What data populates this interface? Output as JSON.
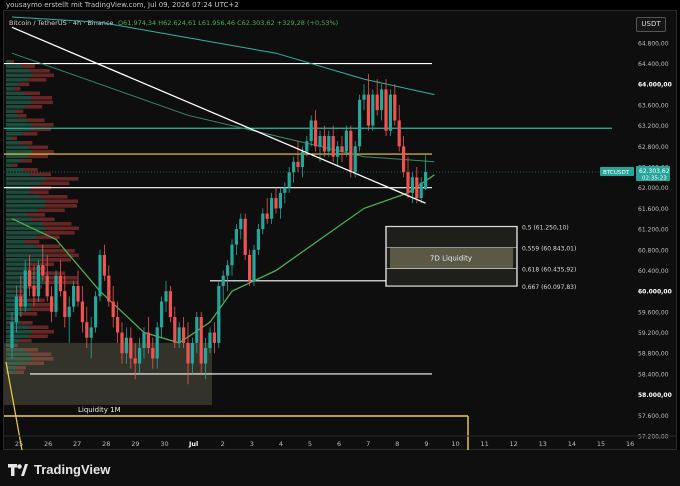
{
  "meta": {
    "author_line": "yousaymo erstellt mit TradingView.com, Jul 09, 2026 07:24 UTC+2"
  },
  "header": {
    "symbol": "Bitcoin / TetherUS · 4h · Binance",
    "ohlc": "O61.974,34 H62.624,61 L61.956,46 C62.303,62 +329,28 (+0,53%)"
  },
  "currency_button": "USDT",
  "brand": "TradingView",
  "colors": {
    "background": "#0e0e0e",
    "up": "#26a69a",
    "up_bright": "#4caf50",
    "down": "#ef5350",
    "ema_green": "#4caf50",
    "teal_line": "#2fb4a0",
    "yellow": "#f0d04a",
    "white": "#ffffff",
    "price_tag": "#26a69a",
    "zone_fill": "#8a8a6a"
  },
  "chart_data": {
    "type": "candlestick",
    "interval": "4h",
    "price_axis": {
      "min": 57200,
      "max": 65300,
      "ticks": [
        "64.800,00",
        "64.400,00",
        "64.000,00",
        "63.600,00",
        "63.200,00",
        "62.800,00",
        "62.400,00",
        "62.000,00",
        "61.600,00",
        "61.200,00",
        "60.800,00",
        "60.400,00",
        "60.000,00",
        "59.600,00",
        "59.200,00",
        "58.800,00",
        "58.400,00",
        "58.000,00",
        "57.600,00",
        "57.200,00"
      ],
      "tick_values": [
        64800,
        64400,
        64000,
        63600,
        63200,
        62800,
        62400,
        62000,
        61600,
        61200,
        60800,
        60400,
        60000,
        59600,
        59200,
        58800,
        58400,
        58000,
        57600,
        57200
      ],
      "bold_ticks": [
        64000,
        60000,
        58000
      ]
    },
    "time_axis": {
      "labels": [
        "25",
        "26",
        "27",
        "28",
        "29",
        "30",
        "Jul",
        "2",
        "3",
        "4",
        "5",
        "6",
        "7",
        "8",
        "9",
        "10",
        "11",
        "12",
        "13",
        "14",
        "15",
        "16"
      ],
      "bold_labels": [
        "Jul"
      ]
    },
    "current_price": {
      "symbol": "BTCUSDT",
      "price": "62.303,62",
      "value": 62303.62,
      "countdown": "02:35:23"
    },
    "candles": [
      [
        58900,
        59600,
        58700,
        59400
      ],
      [
        59400,
        60100,
        59200,
        59900
      ],
      [
        59900,
        60300,
        59500,
        59700
      ],
      [
        59700,
        60600,
        59600,
        60400
      ],
      [
        60400,
        60700,
        59900,
        60100
      ],
      [
        60100,
        60500,
        59700,
        59900
      ],
      [
        59900,
        60600,
        59800,
        60500
      ],
      [
        60500,
        60900,
        60200,
        60300
      ],
      [
        60300,
        60700,
        59800,
        59900
      ],
      [
        59900,
        60100,
        59400,
        59600
      ],
      [
        59600,
        60400,
        59500,
        60300
      ],
      [
        60300,
        60600,
        59900,
        60000
      ],
      [
        60000,
        60300,
        59300,
        59500
      ],
      [
        59500,
        59900,
        59000,
        59700
      ],
      [
        59700,
        60200,
        59600,
        60100
      ],
      [
        60100,
        60400,
        59700,
        59800
      ],
      [
        59800,
        60100,
        59200,
        59400
      ],
      [
        59400,
        59700,
        58900,
        59100
      ],
      [
        59100,
        59500,
        58700,
        59300
      ],
      [
        59300,
        60000,
        59200,
        59900
      ],
      [
        59900,
        60800,
        59800,
        60700
      ],
      [
        60700,
        60900,
        60200,
        60300
      ],
      [
        60300,
        60500,
        59700,
        59800
      ],
      [
        59800,
        60100,
        59300,
        59500
      ],
      [
        59500,
        59800,
        59000,
        59200
      ],
      [
        59200,
        59400,
        58600,
        58800
      ],
      [
        58800,
        59300,
        58600,
        59100
      ],
      [
        59100,
        59300,
        58500,
        58700
      ],
      [
        58700,
        59000,
        58300,
        58600
      ],
      [
        58600,
        59100,
        58400,
        58900
      ],
      [
        58900,
        59300,
        58700,
        59200
      ],
      [
        59200,
        59500,
        58800,
        58900
      ],
      [
        58900,
        59100,
        58500,
        58700
      ],
      [
        58700,
        59400,
        58500,
        59300
      ],
      [
        59300,
        59900,
        59100,
        59800
      ],
      [
        59800,
        60200,
        59600,
        60000
      ],
      [
        60000,
        60100,
        59400,
        59500
      ],
      [
        59500,
        59700,
        58900,
        59000
      ],
      [
        59000,
        59400,
        58900,
        59300
      ],
      [
        59300,
        59500,
        58900,
        59000
      ],
      [
        59000,
        59400,
        58200,
        58600
      ],
      [
        58600,
        59100,
        58400,
        59000
      ],
      [
        59000,
        59600,
        58800,
        59500
      ],
      [
        59500,
        59600,
        58400,
        58600
      ],
      [
        58600,
        59100,
        58300,
        58900
      ],
      [
        58900,
        59300,
        58800,
        59200
      ],
      [
        59200,
        59400,
        58800,
        59000
      ],
      [
        59000,
        60200,
        58900,
        60100
      ],
      [
        60100,
        60400,
        59800,
        60300
      ],
      [
        60300,
        60600,
        60000,
        60500
      ],
      [
        60500,
        61000,
        60300,
        60900
      ],
      [
        60900,
        61300,
        60700,
        61200
      ],
      [
        61200,
        61500,
        61000,
        61400
      ],
      [
        61400,
        61500,
        60600,
        60700
      ],
      [
        60700,
        60800,
        60100,
        60200
      ],
      [
        60200,
        60900,
        60100,
        60800
      ],
      [
        60800,
        61300,
        60700,
        61200
      ],
      [
        61200,
        61600,
        61100,
        61500
      ],
      [
        61500,
        61800,
        61300,
        61400
      ],
      [
        61400,
        61900,
        61300,
        61800
      ],
      [
        61800,
        62000,
        61500,
        61600
      ],
      [
        61600,
        62000,
        61400,
        61900
      ],
      [
        61900,
        62100,
        61700,
        62000
      ],
      [
        62000,
        62400,
        61900,
        62300
      ],
      [
        62300,
        62600,
        62100,
        62500
      ],
      [
        62500,
        62900,
        62300,
        62400
      ],
      [
        62400,
        62800,
        62200,
        62700
      ],
      [
        62700,
        63000,
        62600,
        62900
      ],
      [
        62900,
        63400,
        62800,
        63300
      ],
      [
        63300,
        63500,
        62700,
        62800
      ],
      [
        62800,
        63100,
        62500,
        63000
      ],
      [
        63000,
        63200,
        62600,
        62700
      ],
      [
        62700,
        63100,
        62600,
        63000
      ],
      [
        63000,
        63200,
        62500,
        62600
      ],
      [
        62600,
        62900,
        62400,
        62800
      ],
      [
        62800,
        63000,
        62500,
        62700
      ],
      [
        62700,
        63200,
        62600,
        63100
      ],
      [
        63100,
        63200,
        62200,
        62300
      ],
      [
        62300,
        62900,
        62200,
        62800
      ],
      [
        62800,
        63800,
        62700,
        63700
      ],
      [
        63700,
        64000,
        63500,
        63800
      ],
      [
        63800,
        64200,
        63100,
        63200
      ],
      [
        63200,
        63900,
        63100,
        63800
      ],
      [
        63800,
        64100,
        63400,
        63500
      ],
      [
        63500,
        64000,
        63300,
        63900
      ],
      [
        63900,
        64100,
        63000,
        63100
      ],
      [
        63100,
        63900,
        63000,
        63800
      ],
      [
        63800,
        64000,
        63200,
        63300
      ],
      [
        63300,
        63600,
        62700,
        62800
      ],
      [
        62800,
        63000,
        62200,
        62300
      ],
      [
        62300,
        62600,
        61800,
        61900
      ],
      [
        61900,
        62300,
        61700,
        62200
      ],
      [
        62200,
        62400,
        61700,
        61800
      ],
      [
        61800,
        62200,
        61700,
        62100
      ],
      [
        61974,
        62625,
        61956,
        62304
      ]
    ],
    "lines": {
      "ema_main": [
        [
          0,
          61400
        ],
        [
          10,
          61000
        ],
        [
          20,
          60000
        ],
        [
          30,
          59200
        ],
        [
          38,
          59000
        ],
        [
          45,
          59400
        ],
        [
          50,
          60000
        ],
        [
          60,
          60400
        ],
        [
          70,
          61000
        ],
        [
          80,
          61600
        ],
        [
          90,
          61900
        ],
        [
          96,
          62250
        ]
      ],
      "ema_upper": [
        [
          0,
          64600
        ],
        [
          20,
          64000
        ],
        [
          40,
          63400
        ],
        [
          60,
          63000
        ],
        [
          80,
          62600
        ],
        [
          96,
          62500
        ]
      ],
      "ema_teal": [
        [
          0,
          65300
        ],
        [
          20,
          65200
        ],
        [
          40,
          64900
        ],
        [
          60,
          64600
        ],
        [
          80,
          64100
        ],
        [
          96,
          63800
        ]
      ],
      "downtrend": [
        [
          0,
          65100
        ],
        [
          94,
          61700
        ]
      ]
    },
    "levels": [
      {
        "name": "white-top",
        "price": 64400,
        "color": "white"
      },
      {
        "name": "cyan",
        "price": 63150,
        "color": "teal"
      },
      {
        "name": "yellow",
        "price": 62650,
        "color": "yellow"
      },
      {
        "name": "white-mid",
        "price": 62000,
        "color": "white"
      },
      {
        "name": "white-low",
        "price": 60200,
        "color": "white"
      },
      {
        "name": "white-58k",
        "price": 58400,
        "color": "white"
      }
    ],
    "fib": [
      {
        "label": "0,5 (61.250,10)",
        "price": 61250.1
      },
      {
        "label": "0,559 (60.843,01)",
        "price": 60843.01
      },
      {
        "label": "0,618 (60.435,92)",
        "price": 60435.92
      },
      {
        "label": "0,667 (60.097,83)",
        "price": 60097.83
      }
    ],
    "zone_label": "7D Liquidity",
    "liquidity_label": "Liquidity 1M"
  }
}
